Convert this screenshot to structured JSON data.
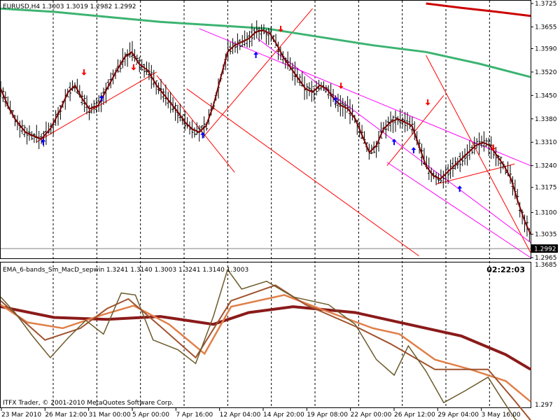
{
  "header": {
    "symbol_info": "EURUSD,H4  1.3003 1.3019 1.2982 1.2992",
    "indicator_info": "EMA_6-bands_Sm_MacD_sepwin 1.3241 1.3140 1.3003 1.3241 1.3140 1.3003",
    "timer": "02:22:03",
    "copyright": "ITFX Trader, © 2001-2010 MetaQuotes Software Corp."
  },
  "colors": {
    "price_axis_bg": "#000000",
    "grid": "#000000",
    "bars": "#000000",
    "ema_price": "#800000",
    "ema_slow_green": "#3cb371",
    "ema_fast_red": "#cc0000",
    "channel_red": "#ff0000",
    "channel_magenta": "#ff00ff",
    "arrow_up": "#0000ff",
    "arrow_down": "#ff0000",
    "ind_dark": "#8b1a1a",
    "ind_orange": "#e0804a",
    "ind_brown": "#a0522d",
    "ind_olive": "#6b5a2a"
  },
  "chart_data": [
    {
      "type": "candlestick",
      "name": "EURUSD,H4",
      "y_ticks": [
        "1.3725",
        "1.3655",
        "1.3590",
        "1.3520",
        "1.3450",
        "1.3380",
        "1.3310",
        "1.3240",
        "1.3175",
        "1.3100",
        "1.3035",
        "1.2965"
      ],
      "current_price": "1.2992",
      "ylim": [
        1.2965,
        1.3725
      ],
      "x_ticks": [
        "23 Mar 2010",
        "26 Mar 12:00",
        "31 Mar 00:00",
        "5 Apr 00:00",
        "7 Apr 16:00",
        "12 Apr 04:00",
        "14 Apr 20:00",
        "19 Apr 08:00",
        "22 Apr 00:00",
        "26 Apr 12:00",
        "29 Apr 04:00",
        "3 May 16:00"
      ],
      "price_path": [
        [
          0,
          1.347
        ],
        [
          4,
          1.342
        ],
        [
          8,
          1.338
        ],
        [
          14,
          1.334
        ],
        [
          18,
          1.333
        ],
        [
          23,
          1.332
        ],
        [
          28,
          1.335
        ],
        [
          33,
          1.34
        ],
        [
          38,
          1.346
        ],
        [
          42,
          1.348
        ],
        [
          46,
          1.344
        ],
        [
          50,
          1.341
        ],
        [
          55,
          1.342
        ],
        [
          60,
          1.347
        ],
        [
          65,
          1.352
        ],
        [
          70,
          1.3565
        ],
        [
          74,
          1.358
        ],
        [
          78,
          1.3545
        ],
        [
          83,
          1.3525
        ],
        [
          88,
          1.348
        ],
        [
          94,
          1.344
        ],
        [
          100,
          1.34
        ],
        [
          104,
          1.337
        ],
        [
          108,
          1.335
        ],
        [
          112,
          1.334
        ],
        [
          116,
          1.336
        ],
        [
          120,
          1.342
        ],
        [
          124,
          1.35
        ],
        [
          128,
          1.358
        ],
        [
          132,
          1.36
        ],
        [
          136,
          1.361
        ],
        [
          140,
          1.362
        ],
        [
          144,
          1.364
        ],
        [
          148,
          1.3645
        ],
        [
          152,
          1.3635
        ],
        [
          156,
          1.36
        ],
        [
          160,
          1.356
        ],
        [
          164,
          1.353
        ],
        [
          168,
          1.35
        ],
        [
          172,
          1.347
        ],
        [
          176,
          1.346
        ],
        [
          180,
          1.348
        ],
        [
          184,
          1.347
        ],
        [
          188,
          1.344
        ],
        [
          192,
          1.342
        ],
        [
          196,
          1.341
        ],
        [
          200,
          1.338
        ],
        [
          204,
          1.333
        ],
        [
          208,
          1.328
        ],
        [
          212,
          1.33
        ],
        [
          216,
          1.335
        ],
        [
          220,
          1.337
        ],
        [
          224,
          1.338
        ],
        [
          228,
          1.337
        ],
        [
          232,
          1.336
        ],
        [
          236,
          1.33
        ],
        [
          240,
          1.324
        ],
        [
          244,
          1.321
        ],
        [
          248,
          1.32
        ],
        [
          252,
          1.322
        ],
        [
          256,
          1.324
        ],
        [
          260,
          1.326
        ],
        [
          264,
          1.328
        ],
        [
          268,
          1.33
        ],
        [
          272,
          1.331
        ],
        [
          276,
          1.33
        ],
        [
          280,
          1.327
        ],
        [
          284,
          1.324
        ],
        [
          288,
          1.32
        ],
        [
          292,
          1.313
        ],
        [
          296,
          1.307
        ],
        [
          299,
          1.3035
        ]
      ],
      "ema_slow_green": [
        [
          0,
          1.371
        ],
        [
          30,
          1.37
        ],
        [
          60,
          1.3685
        ],
        [
          90,
          1.367
        ],
        [
          120,
          1.366
        ],
        [
          150,
          1.365
        ],
        [
          180,
          1.3625
        ],
        [
          210,
          1.36
        ],
        [
          240,
          1.358
        ],
        [
          270,
          1.3545
        ],
        [
          299,
          1.3505
        ]
      ],
      "ema_fast_red": [
        [
          240,
          1.3725
        ],
        [
          260,
          1.3712
        ],
        [
          280,
          1.37
        ],
        [
          299,
          1.3688
        ]
      ],
      "channels_red": [
        [
          [
            20,
            1.331
          ],
          [
            88,
            1.352
          ]
        ],
        [
          [
            88,
            1.351
          ],
          [
            132,
            1.322
          ]
        ],
        [
          [
            115,
            1.333
          ],
          [
            176,
            1.371
          ]
        ],
        [
          [
            105,
            1.347
          ],
          [
            236,
            1.297
          ]
        ],
        [
          [
            218,
            1.324
          ],
          [
            250,
            1.345
          ]
        ],
        [
          [
            246,
            1.3185
          ],
          [
            290,
            1.3245
          ]
        ],
        [
          [
            240,
            1.357
          ],
          [
            299,
            1.298
          ]
        ]
      ],
      "channels_magenta": [
        [
          [
            112,
            1.365
          ],
          [
            299,
            1.324
          ]
        ],
        [
          [
            145,
            1.362
          ],
          [
            299,
            1.301
          ]
        ],
        [
          [
            218,
            1.325
          ],
          [
            299,
            1.2965
          ]
        ]
      ],
      "arrows_up": [
        [
          24,
          1.331
        ],
        [
          57,
          1.344
        ],
        [
          114,
          1.333
        ],
        [
          144,
          1.357
        ],
        [
          189,
          1.3435
        ],
        [
          222,
          1.331
        ],
        [
          233,
          1.3285
        ],
        [
          259,
          1.317
        ]
      ],
      "arrows_down": [
        [
          47,
          1.352
        ],
        [
          75,
          1.3535
        ],
        [
          158,
          1.365
        ],
        [
          192,
          1.348
        ],
        [
          241,
          1.343
        ],
        [
          278,
          1.3295
        ]
      ]
    },
    {
      "type": "line",
      "name": "EMA_6-bands_Sm_MacD_sepwin",
      "y_ticks": [
        "1.3685",
        "1.297"
      ],
      "ylim": [
        1.297,
        1.3685
      ],
      "series": [
        {
          "role": "slow-thick",
          "points": [
            [
              0,
              1.347
            ],
            [
              30,
              1.3415
            ],
            [
              60,
              1.3405
            ],
            [
              90,
              1.342
            ],
            [
              120,
              1.338
            ],
            [
              140,
              1.344
            ],
            [
              165,
              1.347
            ],
            [
              200,
              1.344
            ],
            [
              230,
              1.338
            ],
            [
              260,
              1.332
            ],
            [
              285,
              1.3225
            ],
            [
              299,
              1.315
            ]
          ]
        },
        {
          "role": "mid-orange",
          "points": [
            [
              0,
              1.348
            ],
            [
              15,
              1.339
            ],
            [
              35,
              1.336
            ],
            [
              58,
              1.343
            ],
            [
              75,
              1.3475
            ],
            [
              95,
              1.338
            ],
            [
              115,
              1.323
            ],
            [
              130,
              1.347
            ],
            [
              160,
              1.353
            ],
            [
              180,
              1.346
            ],
            [
              210,
              1.336
            ],
            [
              225,
              1.333
            ],
            [
              245,
              1.32
            ],
            [
              265,
              1.315
            ],
            [
              285,
              1.309
            ],
            [
              299,
              1.2985
            ]
          ]
        },
        {
          "role": "fast-brown",
          "points": [
            [
              0,
              1.35
            ],
            [
              10,
              1.342
            ],
            [
              25,
              1.33
            ],
            [
              45,
              1.336
            ],
            [
              60,
              1.346
            ],
            [
              72,
              1.351
            ],
            [
              90,
              1.337
            ],
            [
              110,
              1.321
            ],
            [
              130,
              1.35
            ],
            [
              155,
              1.358
            ],
            [
              172,
              1.348
            ],
            [
              200,
              1.337
            ],
            [
              220,
              1.328
            ],
            [
              245,
              1.315
            ],
            [
              275,
              1.315
            ],
            [
              290,
              1.299
            ],
            [
              299,
              1.289
            ]
          ]
        },
        {
          "role": "fastest-olive",
          "points": [
            [
              0,
              1.352
            ],
            [
              8,
              1.344
            ],
            [
              18,
              1.332
            ],
            [
              28,
              1.321
            ],
            [
              38,
              1.331
            ],
            [
              48,
              1.34
            ],
            [
              58,
              1.333
            ],
            [
              68,
              1.354
            ],
            [
              76,
              1.353
            ],
            [
              86,
              1.33
            ],
            [
              100,
              1.325
            ],
            [
              110,
              1.318
            ],
            [
              120,
              1.342
            ],
            [
              128,
              1.366
            ],
            [
              136,
              1.356
            ],
            [
              150,
              1.36
            ],
            [
              165,
              1.352
            ],
            [
              185,
              1.348
            ],
            [
              200,
              1.338
            ],
            [
              212,
              1.32
            ],
            [
              222,
              1.312
            ],
            [
              230,
              1.327
            ],
            [
              240,
              1.314
            ],
            [
              250,
              1.298
            ],
            [
              262,
              1.304
            ],
            [
              275,
              1.311
            ],
            [
              282,
              1.301
            ],
            [
              290,
              1.29
            ],
            [
              299,
              1.282
            ]
          ]
        }
      ]
    }
  ]
}
